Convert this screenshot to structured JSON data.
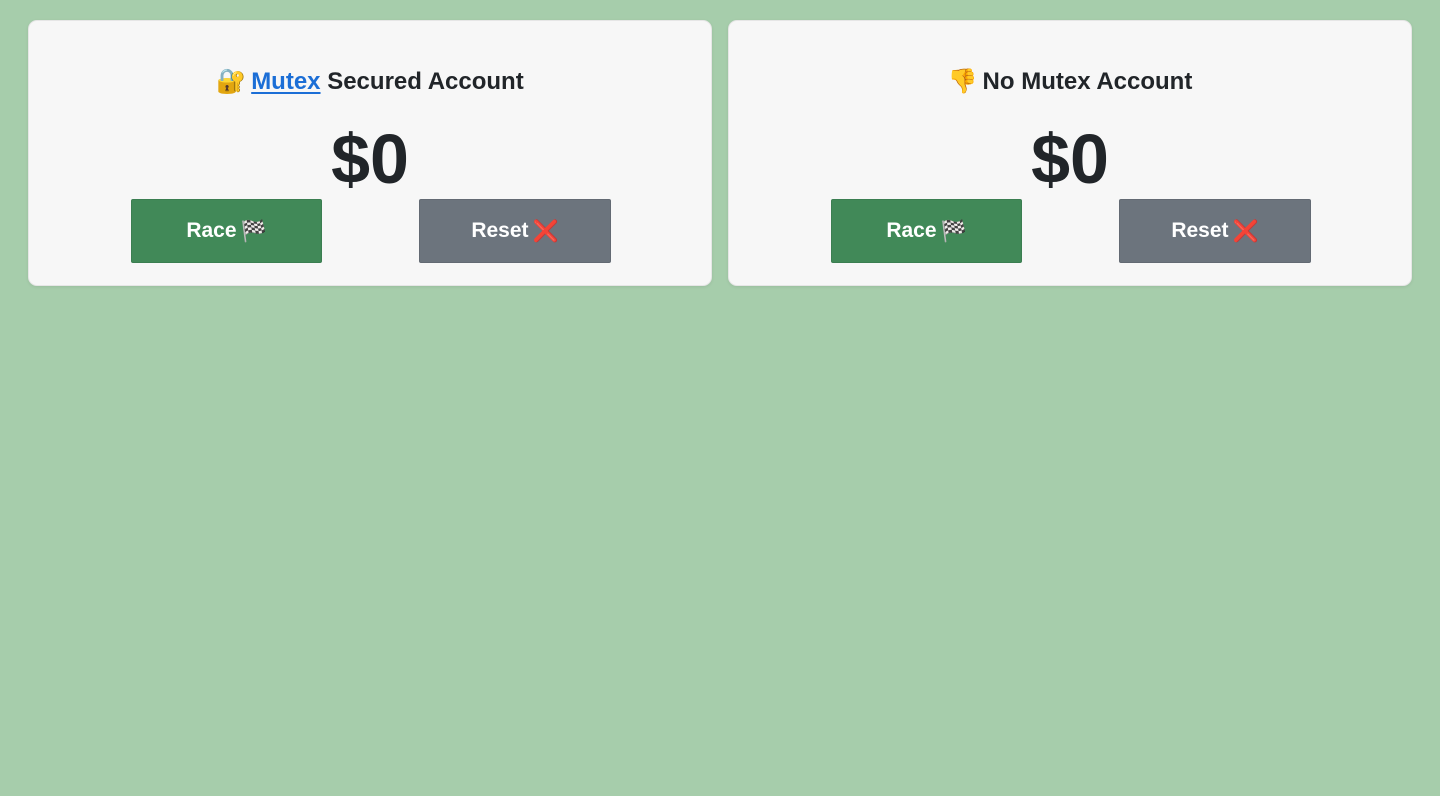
{
  "cards": [
    {
      "title_prefix_icon": "lock-with-key-icon",
      "title_emoji": "🔐",
      "title_link": "Mutex",
      "title_rest": "Secured Account",
      "balance": "$0",
      "race_label": "Race",
      "race_icon": "checkered-flag-icon",
      "race_emoji": "🏁",
      "reset_label": "Reset",
      "reset_icon": "cross-mark-icon",
      "reset_emoji": "❌"
    },
    {
      "title_prefix_icon": "thumbs-down-icon",
      "title_emoji": "👎",
      "title_text": "No Mutex Account",
      "balance": "$0",
      "race_label": "Race",
      "race_icon": "checkered-flag-icon",
      "race_emoji": "🏁",
      "reset_label": "Reset",
      "reset_icon": "cross-mark-icon",
      "reset_emoji": "❌"
    }
  ],
  "colors": {
    "background": "#a6cdab",
    "card": "#f7f7f7",
    "race_button": "#418958",
    "reset_button": "#6c747d",
    "link": "#1b6ed6",
    "text": "#212529"
  }
}
